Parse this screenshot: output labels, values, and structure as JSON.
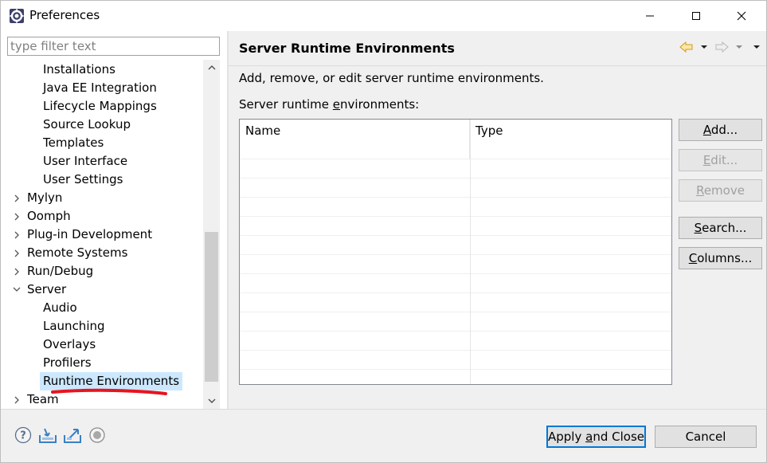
{
  "window": {
    "title": "Preferences"
  },
  "filter": {
    "placeholder": "type filter text",
    "value": ""
  },
  "tree": {
    "items": [
      {
        "label": "Installations",
        "level": 1
      },
      {
        "label": "Java EE Integration",
        "level": 1
      },
      {
        "label": "Lifecycle Mappings",
        "level": 1
      },
      {
        "label": "Source Lookup",
        "level": 1
      },
      {
        "label": "Templates",
        "level": 1
      },
      {
        "label": "User Interface",
        "level": 1
      },
      {
        "label": "User Settings",
        "level": 1
      },
      {
        "label": "Mylyn",
        "level": 0,
        "expanded": false
      },
      {
        "label": "Oomph",
        "level": 0,
        "expanded": false
      },
      {
        "label": "Plug-in Development",
        "level": 0,
        "expanded": false
      },
      {
        "label": "Remote Systems",
        "level": 0,
        "expanded": false
      },
      {
        "label": "Run/Debug",
        "level": 0,
        "expanded": false
      },
      {
        "label": "Server",
        "level": 0,
        "expanded": true
      },
      {
        "label": "Audio",
        "level": 1
      },
      {
        "label": "Launching",
        "level": 1
      },
      {
        "label": "Overlays",
        "level": 1
      },
      {
        "label": "Profilers",
        "level": 1
      },
      {
        "label": "Runtime Environments",
        "level": 1,
        "selected": true
      },
      {
        "label": "Team",
        "level": 0,
        "expanded": false
      }
    ]
  },
  "page": {
    "title": "Server Runtime Environments",
    "description": "Add, remove, or edit server runtime environments.",
    "list_label_pre": "Server runtime ",
    "list_label_mnemonic": "e",
    "list_label_post": "nvironments:",
    "columns": [
      "Name",
      "Type"
    ]
  },
  "buttons": {
    "add": {
      "mnemonic": "A",
      "rest": "dd...",
      "enabled": true
    },
    "edit": {
      "mnemonic": "E",
      "rest": "dit...",
      "enabled": false
    },
    "remove": {
      "mnemonic": "R",
      "rest": "emove",
      "enabled": false
    },
    "search": {
      "mnemonic": "S",
      "rest": "earch...",
      "enabled": true
    },
    "columns": {
      "mnemonic": "C",
      "rest": "olumns...",
      "enabled": true
    }
  },
  "footer": {
    "apply_close_pre": "Apply ",
    "apply_close_mnemonic": "a",
    "apply_close_post": "nd Close",
    "cancel": "Cancel"
  },
  "icons": {
    "app": "eclipse-gear-icon",
    "help": "help-icon",
    "import": "import-icon",
    "export": "export-icon",
    "record": "record-icon",
    "back": "back-arrow-icon",
    "forward": "forward-arrow-icon"
  },
  "colors": {
    "selection": "#cce8ff",
    "nav_arrow": "#e0a020",
    "annotation_red": "#e8141e",
    "default_button_border": "#0078d7"
  }
}
